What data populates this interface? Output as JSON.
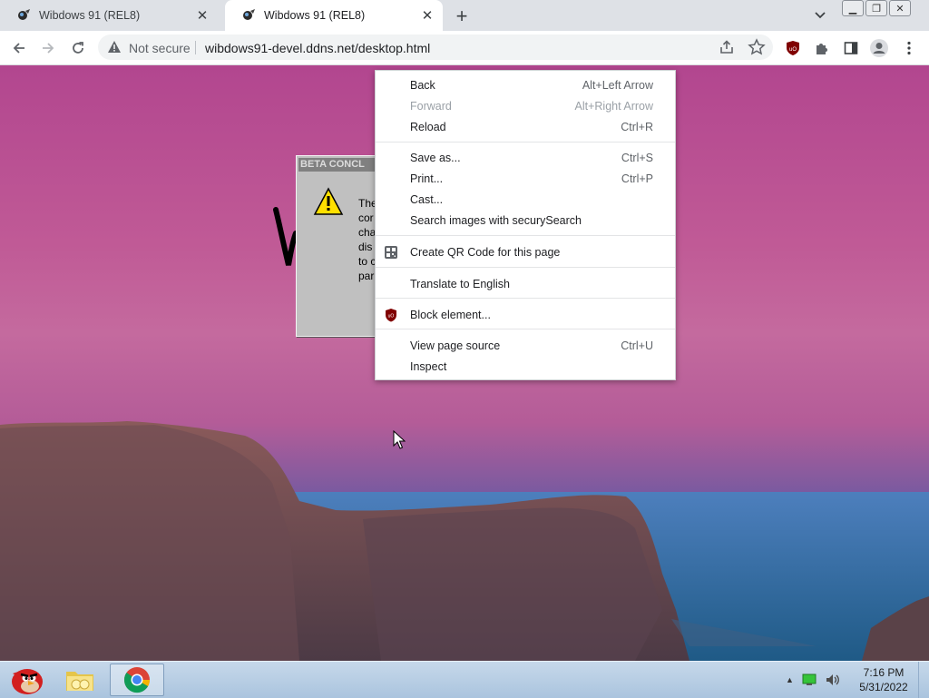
{
  "browser": {
    "tabs": [
      {
        "title": "Wibdows 91 (REL8)",
        "active": false
      },
      {
        "title": "Wibdows 91 (REL8)",
        "active": true
      }
    ],
    "new_tab_label": "+",
    "address": {
      "security_label": "Not secure",
      "url": "wibdows91-devel.ddns.net/desktop.html"
    }
  },
  "dialog": {
    "title": "BETA CONCL",
    "text": "The\ncor\ncha\ndis\nto c\npar"
  },
  "context_menu": {
    "groups": [
      [
        {
          "label": "Back",
          "shortcut": "Alt+Left Arrow",
          "disabled": false
        },
        {
          "label": "Forward",
          "shortcut": "Alt+Right Arrow",
          "disabled": true
        },
        {
          "label": "Reload",
          "shortcut": "Ctrl+R",
          "disabled": false
        }
      ],
      [
        {
          "label": "Save as...",
          "shortcut": "Ctrl+S",
          "disabled": false
        },
        {
          "label": "Print...",
          "shortcut": "Ctrl+P",
          "disabled": false
        },
        {
          "label": "Cast...",
          "shortcut": "",
          "disabled": false
        },
        {
          "label": "Search images with securySearch",
          "shortcut": "",
          "disabled": false
        }
      ],
      [
        {
          "label": "Create QR Code for this page",
          "shortcut": "",
          "icon": "qr-code-icon"
        }
      ],
      [
        {
          "label": "Translate to English",
          "shortcut": ""
        }
      ],
      [
        {
          "label": "Block element...",
          "shortcut": "",
          "icon": "ublock-icon"
        }
      ],
      [
        {
          "label": "View page source",
          "shortcut": "Ctrl+U"
        },
        {
          "label": "Inspect",
          "shortcut": ""
        }
      ]
    ]
  },
  "taskbar": {
    "apps": [
      "angry-birds-icon",
      "folder-icon",
      "chrome-icon"
    ],
    "clock": {
      "time": "7:16 PM",
      "date": "5/31/2022"
    }
  }
}
